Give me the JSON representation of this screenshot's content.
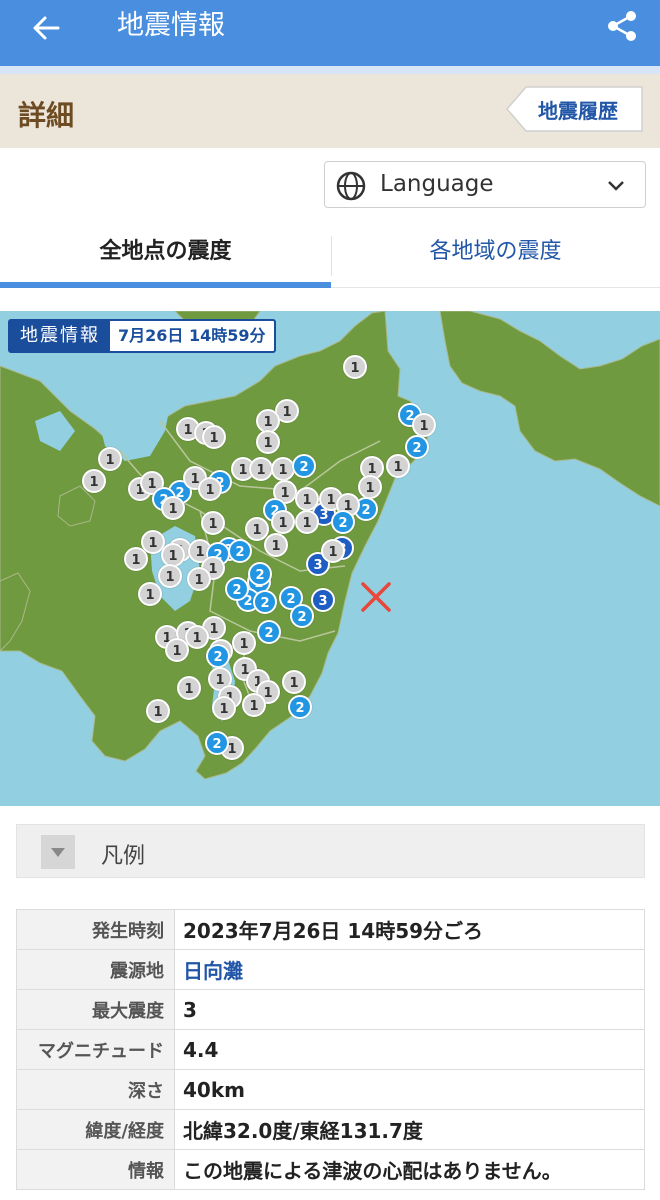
{
  "app_bar": {
    "title": "地震情報",
    "back_icon": "arrow-left-icon",
    "share_icon": "share-icon",
    "color": "#4a8fdf"
  },
  "detail": {
    "label": "詳細",
    "history_button": "地震履歴"
  },
  "language": {
    "label": "Language"
  },
  "tabs": [
    {
      "label": "全地点の震度",
      "active": true
    },
    {
      "label": "各地域の震度",
      "active": false
    }
  ],
  "map": {
    "badge_label": "地震情報",
    "badge_time": "7月26日 14時59分",
    "epicenter_icon": "cross-icon",
    "stations": [
      {
        "i": "1"
      },
      {
        "i": "1"
      },
      {
        "i": "1"
      },
      {
        "i": "1"
      },
      {
        "i": "1"
      },
      {
        "i": "1"
      },
      {
        "i": "1"
      },
      {
        "i": "2"
      },
      {
        "i": "1"
      },
      {
        "i": "1"
      },
      {
        "i": "1"
      },
      {
        "i": "1"
      },
      {
        "i": "1"
      },
      {
        "i": "2"
      },
      {
        "i": "1"
      },
      {
        "i": "1"
      },
      {
        "i": "1"
      },
      {
        "i": "2"
      },
      {
        "i": "2"
      },
      {
        "i": "1"
      },
      {
        "i": "1"
      },
      {
        "i": "1"
      },
      {
        "i": "2"
      },
      {
        "i": "1"
      },
      {
        "i": "2"
      },
      {
        "i": "1"
      },
      {
        "i": "1"
      },
      {
        "i": "3"
      },
      {
        "i": "2"
      },
      {
        "i": "1"
      },
      {
        "i": "2"
      },
      {
        "i": "1"
      },
      {
        "i": "1"
      },
      {
        "i": "2"
      },
      {
        "i": "1"
      },
      {
        "i": "1"
      },
      {
        "i": "1"
      },
      {
        "i": "1"
      },
      {
        "i": "1"
      },
      {
        "i": "3"
      },
      {
        "i": "3"
      },
      {
        "i": "1"
      },
      {
        "i": "2"
      },
      {
        "i": "1"
      },
      {
        "i": "2"
      },
      {
        "i": "2"
      },
      {
        "i": "2"
      },
      {
        "i": "2"
      },
      {
        "i": "3"
      },
      {
        "i": "2"
      },
      {
        "i": "1"
      },
      {
        "i": "1"
      },
      {
        "i": "1"
      },
      {
        "i": "1"
      },
      {
        "i": "2"
      },
      {
        "i": "2"
      },
      {
        "i": "1"
      },
      {
        "i": "1"
      },
      {
        "i": "2"
      },
      {
        "i": "1"
      },
      {
        "i": "1"
      },
      {
        "i": "2"
      },
      {
        "i": "1"
      },
      {
        "i": "2"
      },
      {
        "i": "1"
      },
      {
        "i": "1"
      },
      {
        "i": "1"
      },
      {
        "i": "1"
      },
      {
        "i": "1"
      },
      {
        "i": "1"
      },
      {
        "i": "1"
      },
      {
        "i": "2"
      },
      {
        "i": "1"
      },
      {
        "i": "1"
      },
      {
        "i": "1"
      },
      {
        "i": "1"
      },
      {
        "i": "1"
      },
      {
        "i": "1"
      },
      {
        "i": "1"
      },
      {
        "i": "1"
      },
      {
        "i": "1"
      },
      {
        "i": "1"
      },
      {
        "i": "1"
      },
      {
        "i": "2"
      },
      {
        "i": "2"
      }
    ]
  },
  "legend": {
    "label": "凡例",
    "toggle_icon": "triangle-down-icon"
  },
  "info": [
    {
      "key": "発生時刻",
      "value": "2023年7月26日 14時59分ごろ"
    },
    {
      "key": "震源地",
      "value": "日向灘"
    },
    {
      "key": "最大震度",
      "value": "3"
    },
    {
      "key": "マグニチュード",
      "value": "4.4"
    },
    {
      "key": "深さ",
      "value": "40km"
    },
    {
      "key": "緯度/経度",
      "value": "北緯32.0度/東経131.7度"
    },
    {
      "key": "情報",
      "value": "この地震による津波の心配はありません。"
    }
  ]
}
